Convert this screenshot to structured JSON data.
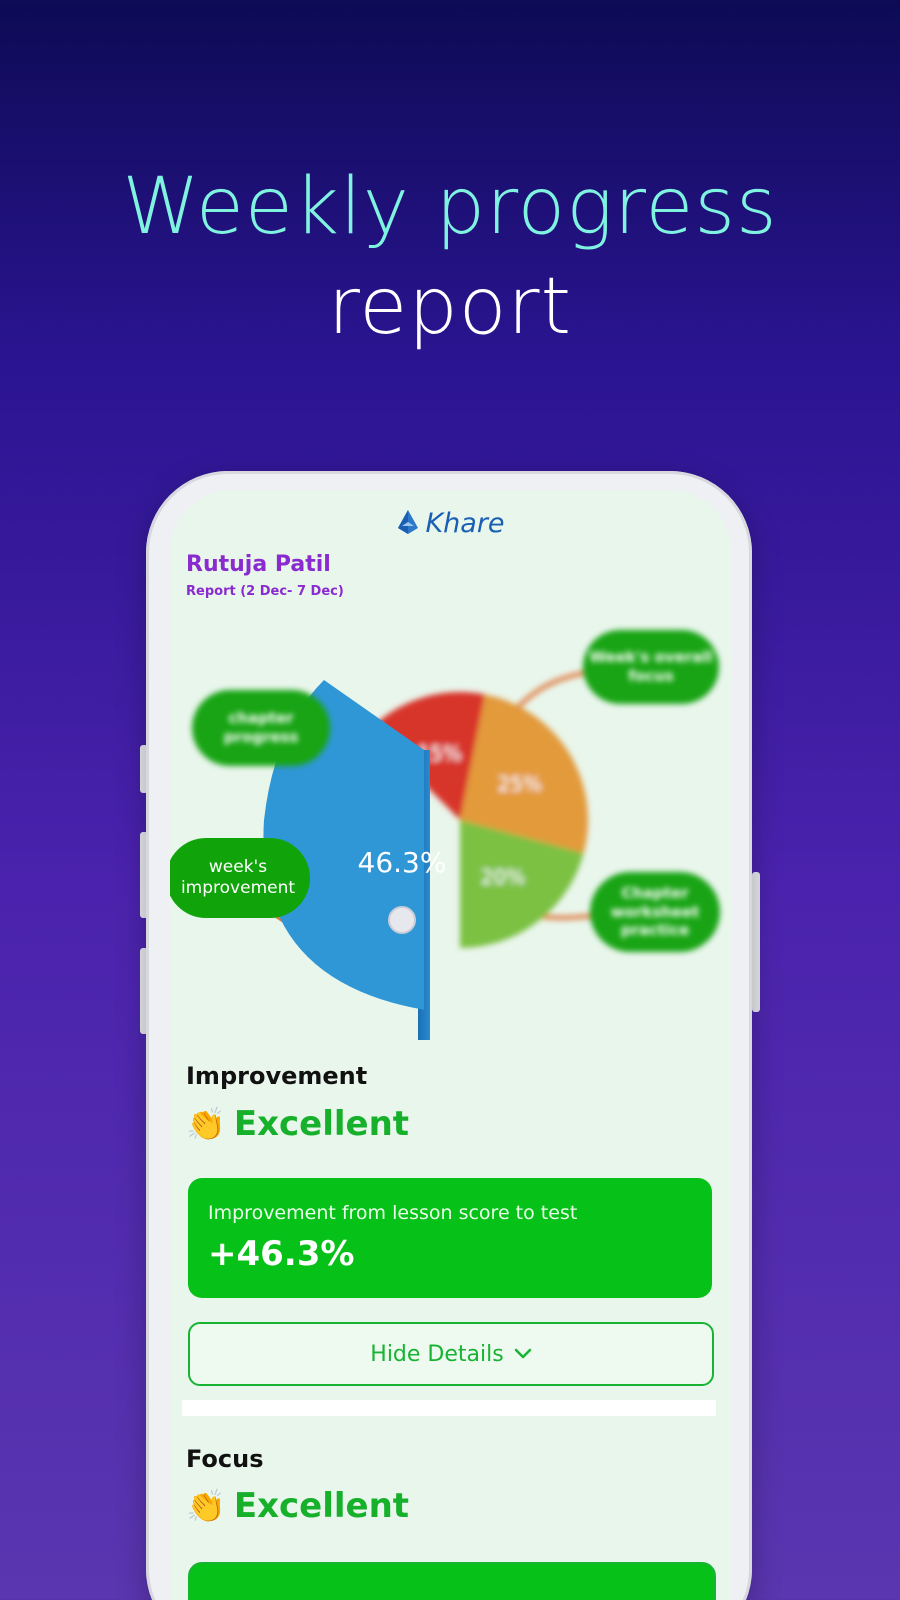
{
  "promo": {
    "headline_line1": "Weekly progress",
    "headline_line2": "report"
  },
  "app": {
    "brand_name": "Khare",
    "brand_color": "#1a5fb4"
  },
  "student": {
    "name": "Rutuja Patil",
    "report_range": "Report (2 Dec- 7 Dec)"
  },
  "chart_data": {
    "type": "pie",
    "title": "",
    "slices": [
      {
        "label": "46.3%",
        "value": 46.3,
        "color": "#2f97d6",
        "callout": "week's improvement",
        "highlighted": true
      },
      {
        "label": "15%",
        "value": 15,
        "color": "#d8352b",
        "callout": "chapter progress",
        "highlighted": false
      },
      {
        "label": "25%",
        "value": 25,
        "color": "#e39a3a",
        "callout": "Week's overall focus",
        "highlighted": false
      },
      {
        "label": "20%",
        "value": 20,
        "color": "#7cc142",
        "callout": "Chapter worksheet practice",
        "highlighted": false
      }
    ]
  },
  "improvement": {
    "section_title": "Improvement",
    "rating_icon": "clapping-hands-icon",
    "rating_emoji": "👏",
    "rating": "Excellent",
    "metric_label": "Improvement from lesson score to test",
    "metric_value": "+46.3%",
    "details_button_label": "Hide Details",
    "details_button_icon": "chevron-down-icon"
  },
  "focus": {
    "section_title": "Focus",
    "rating_emoji": "👏",
    "rating": "Excellent"
  },
  "colors": {
    "accent_green": "#06c218",
    "rating_green": "#16b02b",
    "name_purple": "#8a2bcf",
    "headline_teal": "#7ff3e0"
  }
}
